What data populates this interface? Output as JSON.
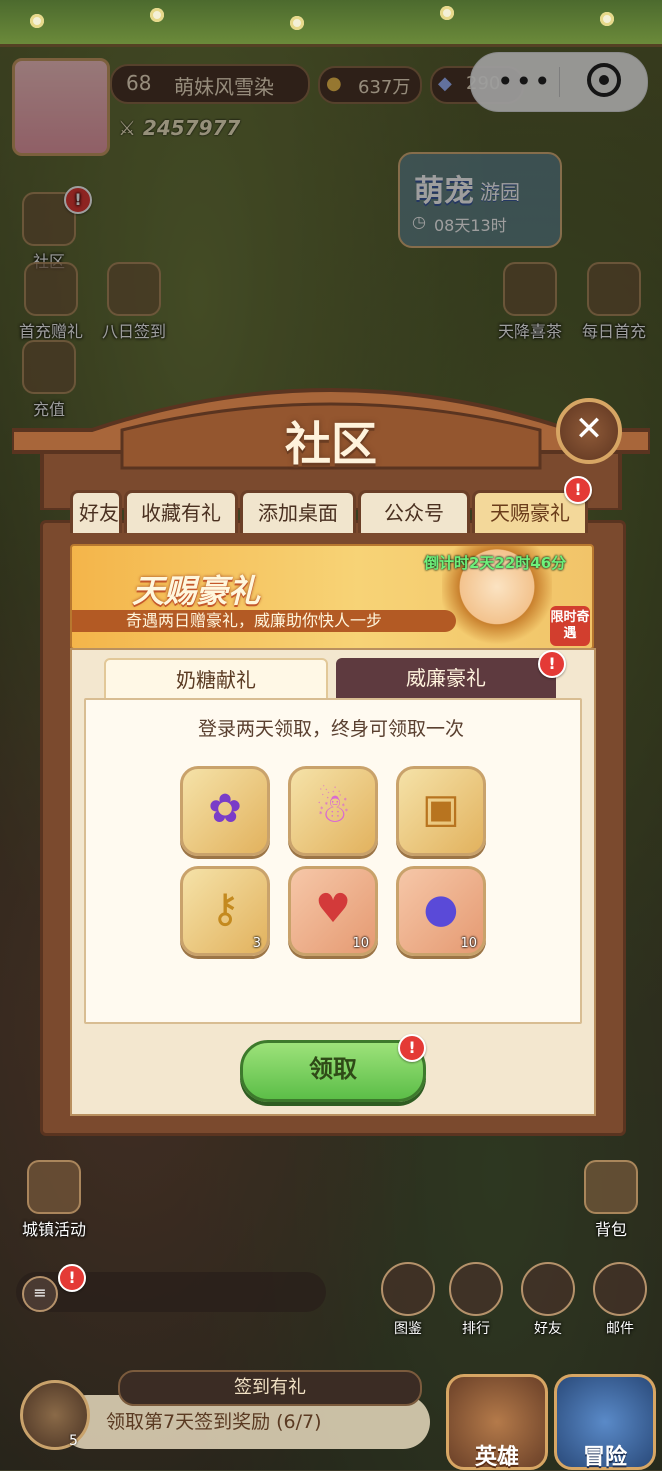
{
  "hud": {
    "level": "68",
    "player_name": "萌妹风雪染",
    "power": "2457977",
    "coins": "637万",
    "gems": "290",
    "pet_event": {
      "title": "萌宠",
      "subtitle": "游园",
      "timer": "08天13时"
    }
  },
  "left_menu": [
    {
      "label": "社区"
    },
    {
      "label": "首充赠礼"
    },
    {
      "label": "八日签到"
    },
    {
      "label": "充值"
    }
  ],
  "right_menu": [
    {
      "label": "天降喜茶"
    },
    {
      "label": "每日首充"
    }
  ],
  "modal": {
    "title": "社区",
    "tabs": [
      {
        "label": "好友"
      },
      {
        "label": "收藏有礼"
      },
      {
        "label": "添加桌面"
      },
      {
        "label": "公众号"
      },
      {
        "label": "天赐豪礼",
        "active": true
      }
    ],
    "banner": {
      "title": "天赐豪礼",
      "subtitle": "奇遇两日赠豪礼，威廉助你快人一步",
      "countdown": "倒计时2天22时46分",
      "limit_badge": "限时奇遇"
    },
    "subtabs": [
      {
        "label": "奶糖献礼"
      },
      {
        "label": "威廉豪礼",
        "active": true
      }
    ],
    "hint": "登录两天领取，终身可领取一次",
    "rewards": [
      {
        "icon": "star-frame-icon",
        "count": ""
      },
      {
        "icon": "rainbow-gingerbread-icon",
        "count": ""
      },
      {
        "icon": "golden-chest-icon",
        "count": ""
      },
      {
        "icon": "golden-key-icon",
        "count": "3"
      },
      {
        "icon": "heart-gem-icon",
        "count": "10"
      },
      {
        "icon": "magic-blob-icon",
        "count": "10"
      }
    ],
    "claim_label": "领取",
    "badge": "!"
  },
  "bottom": {
    "icons": [
      {
        "label": "图鉴"
      },
      {
        "label": "排行"
      },
      {
        "label": "好友"
      },
      {
        "label": "邮件"
      }
    ],
    "side_label_bag": "背包",
    "side_label_town": "城镇活动",
    "signin_title": "签到有礼",
    "signin_text": "领取第7天签到奖励",
    "signin_progress": "(6/7)",
    "signin_badge": "5",
    "hero_label": "英雄",
    "adventure_label": "冒险"
  },
  "colors": {
    "accent_red": "#e43a36",
    "modal_brown": "#7b4a2e",
    "claim_green": "#5cbe48"
  }
}
